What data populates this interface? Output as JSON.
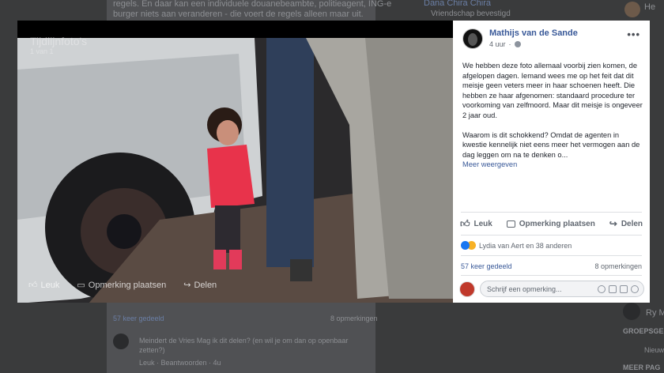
{
  "background": {
    "top_text_1": "regels. En daar kan een individuele douanebeambte, politieagent, ING-er of",
    "top_text_2": "burger niets aan veranderen - die voert de regels alleen maar uit.",
    "top_right_name": "Dana Chira Chira",
    "top_right_sub": "Vriendschap bevestigd",
    "right_name": "He",
    "shares_count": "57 keer gedeeld",
    "comments_count": "8 opmerkingen",
    "comment_preview": "Meindert de Vries Mag ik dit delen? (en wil je om dan op openbaar",
    "comment_preview_2": "zetten?)",
    "comment_actions": "Leuk · Beantwoorden · 4u",
    "right_groups": "GROEPSGE",
    "right_new": "Nieuwe",
    "right_more": "MEER PAG",
    "right_ry": "Ry M"
  },
  "photo": {
    "caption": "Tijdlijnfoto's",
    "caption_sub": "1 van 1",
    "like_label": "Leuk",
    "comment_label": "Opmerking plaatsen",
    "share_label": "Delen"
  },
  "post": {
    "author": "Mathijs van de Sande",
    "time": "4 uur",
    "paragraph1": "We hebben deze foto allemaal voorbij zien komen, de afgelopen dagen. Iemand wees me op het feit dat dit meisje geen veters meer in haar schoenen heeft. Die hebben ze haar afgenomen: standaard procedure ter voorkoming van zelfmoord. Maar dit meisje is ongeveer 2 jaar oud.",
    "paragraph2": "Waarom is dit schokkend? Omdat de agenten in kwestie kennelijk niet eens meer het vermogen aan de dag leggen om na te denken o...",
    "more_link": "Meer weergeven"
  },
  "actions": {
    "like": "Leuk",
    "comment": "Opmerking plaatsen",
    "share": "Delen"
  },
  "reactions": {
    "text": "Lydia van Aert en 38 anderen"
  },
  "stats": {
    "shares": "57 keer gedeeld",
    "comments": "8 opmerkingen"
  },
  "comment_box": {
    "placeholder": "Schrijf een opmerking..."
  }
}
